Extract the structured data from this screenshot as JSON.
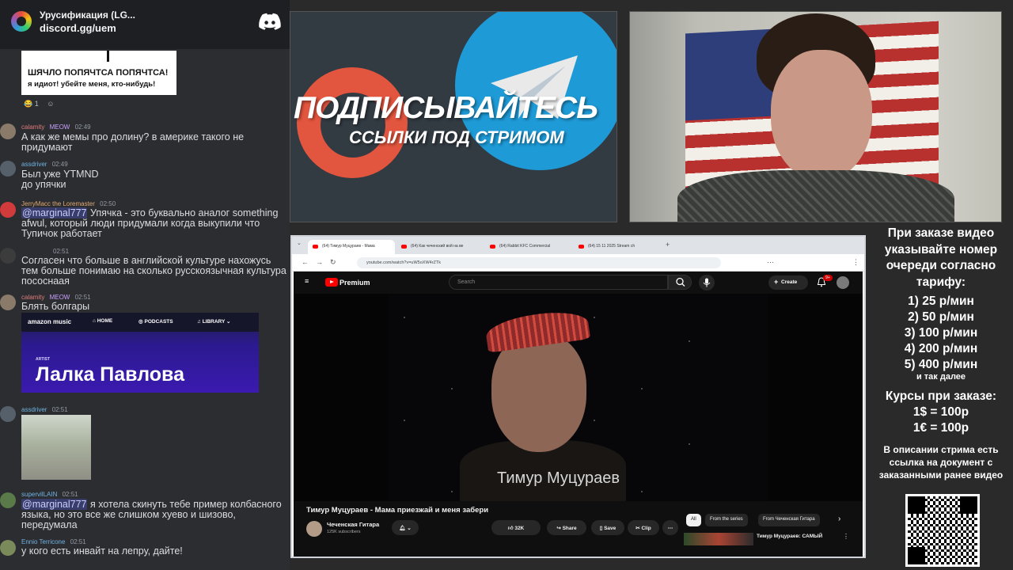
{
  "discord": {
    "server_name": "Урусификация (LG...",
    "invite": "discord.gg/uem",
    "meme": {
      "line1": "ШЯЧЛО ПОПЯЧТСА ПОПЯЧТСА!",
      "line2": "я идиот! убейте меня, кто-нибудь!"
    },
    "reaction_count": "1",
    "messages": [
      {
        "user": "calamity",
        "badge": "MEOW",
        "time": "02:49",
        "text": "А как же мемы про долину? в америке такого не придумают",
        "user_color": "#e07b7b"
      },
      {
        "user": "assdriver",
        "badge": "",
        "time": "02:49",
        "text": "Был уже YTMND\nдо упячки",
        "user_color": "#6fb3e0"
      },
      {
        "user": "JerryMacc the Loremaster",
        "badge": "",
        "time": "02:50",
        "mention": "@marginal777",
        "text": " Упячка - это буквально аналог something afwul, который люди придумали когда выкупили что Тупичок работает",
        "user_color": "#e0a96f"
      },
      {
        "user": "",
        "badge": "",
        "time": "02:51",
        "text": "Согласен что больше в английской культуре нахожусь тем больше понимаю на сколько русскоязычная культура пососнаая",
        "user_color": "#949ba4"
      },
      {
        "user": "calamity",
        "badge": "MEOW",
        "time": "02:51",
        "text": "Блять болгары",
        "user_color": "#e07b7b"
      },
      {
        "user": "assdriver",
        "badge": "",
        "time": "02:51",
        "text": "",
        "user_color": "#6fb3e0"
      },
      {
        "user": "supervilLAIN",
        "badge": "",
        "time": "02:51",
        "mention": "@marginal777",
        "text": " я хотела скинуть тебе пример колбасного языка, но это все же слишком хуево и шизово, передумала",
        "user_color": "#6fb3e0"
      },
      {
        "user": "Ennio Terricone",
        "badge": "",
        "time": "02:51",
        "text": "у кого есть инвайт на лепру, дайте!",
        "user_color": "#6fb3e0"
      }
    ],
    "amazon": {
      "logo": "amazon music",
      "nav": [
        "HOME",
        "PODCASTS",
        "LIBRARY"
      ],
      "artist_label": "ARTIST",
      "artist_name": "Лалка Павлова"
    }
  },
  "banner": {
    "title": "ПОДПИСЫВАЙТЕСЬ",
    "subtitle": "ССЫЛКИ ПОД СТРИМОМ"
  },
  "browser": {
    "tabs": [
      "(64) Тимур Муцураев - Мама",
      "(64) Как чеченский вой на ве",
      "(64) Rabbit KFC Commercial",
      "(64) 15 11 2025 Stream ch"
    ],
    "url": "youtube.com/watch?v=uW5oXW4rZTk",
    "youtube": {
      "brand": "Premium",
      "search_placeholder": "Search",
      "create_label": "Create",
      "notif_count": "9+",
      "caption": "Тимур Муцураев",
      "video_title": "Тимур Муцураев - Мама приезжай и меня забери",
      "channel": "Чеченская Гитара",
      "subscribers": "125K subscribers",
      "likes": "32K",
      "share": "Share",
      "save": "Save",
      "clip": "Clip",
      "chips": [
        "All",
        "From the series",
        "From Чеченская Гитара"
      ],
      "rec_title": "Тимур Муцураев: САМЫЙ"
    }
  },
  "info": {
    "heading": "При заказе видео указывайте номер очереди согласно тарифу:",
    "tiers": [
      "1) 25 р/мин",
      "2) 50 р/мин",
      "3) 100 р/мин",
      "4) 200 р/мин",
      "5) 400 р/мин"
    ],
    "etc": "и так далее",
    "courses_title": "Курсы при заказе:",
    "rates": [
      "1$ = 100р",
      "1€ = 100р"
    ],
    "description": "В описании стрима есть ссылка на документ с заказанными ранее видео"
  }
}
